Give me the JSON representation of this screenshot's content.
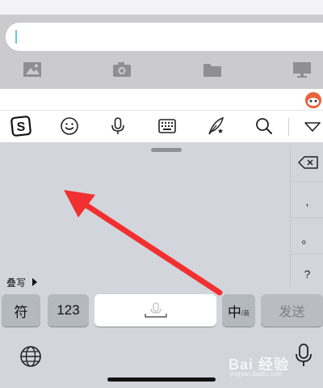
{
  "chat": {
    "tools": [
      "image-icon",
      "camera-icon",
      "folder-icon",
      "desktop-icon"
    ]
  },
  "toolbar": {
    "icons": [
      "sogou-logo-icon",
      "emoji-icon",
      "microphone-icon",
      "keyboard-icon",
      "quill-icon",
      "search-icon",
      "collapse-icon"
    ]
  },
  "keyboard": {
    "punctuation": [
      ",",
      "。",
      "?"
    ],
    "fold_label": "叠写",
    "symbols_key": "符",
    "number_key": "123",
    "lang_key_main": "中",
    "lang_key_sub": "/英",
    "send_key": "发送"
  },
  "watermark": {
    "text": "Bai 经验",
    "url": "jingyan.baidu.com"
  },
  "colors": {
    "arrow": "#f23030",
    "keyboard_bg": "#d2d5db",
    "key_gray": "#b4b8bf"
  }
}
